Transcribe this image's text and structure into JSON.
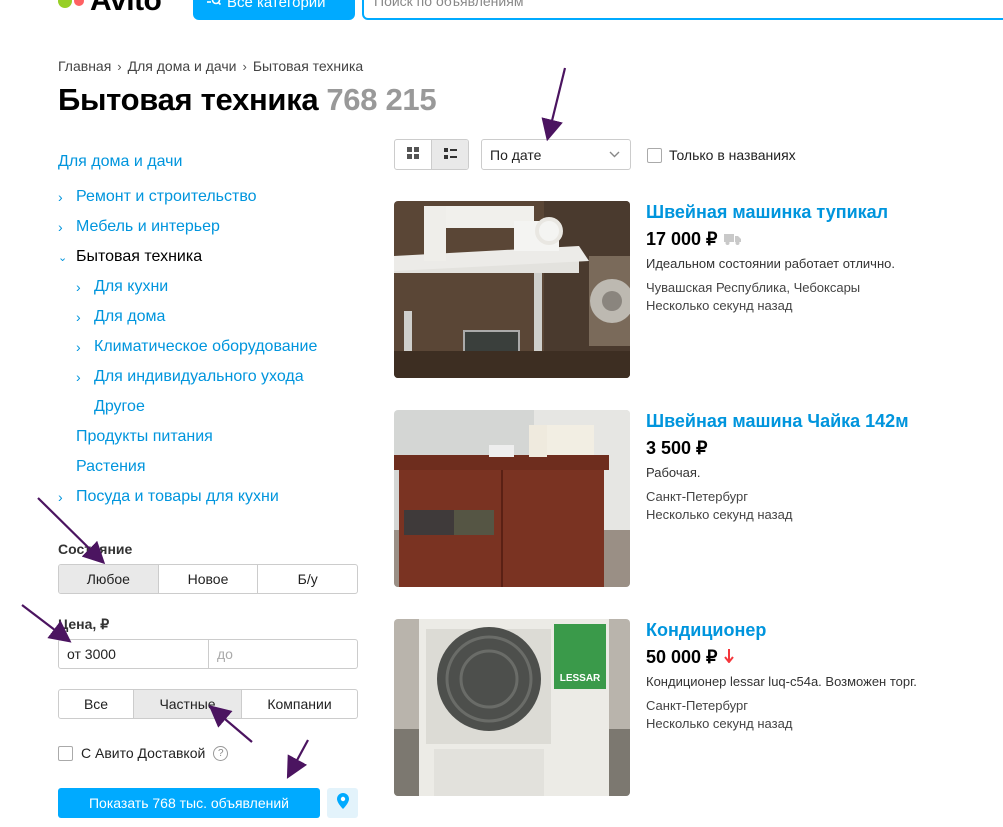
{
  "header": {
    "logo_text": "Avito",
    "logo_colors": [
      "#97cf26",
      "#ff6163",
      "#a169f7",
      "#00aaff"
    ],
    "categories_button": "Все категории",
    "search_placeholder": "Поиск по объявлениям"
  },
  "breadcrumb": [
    "Главная",
    "Для дома и дачи",
    "Бытовая техника"
  ],
  "page": {
    "title": "Бытовая техника",
    "count": "768 215"
  },
  "sidebar": {
    "heading": "Для дома и дачи",
    "items": [
      {
        "label": "Ремонт и строительство",
        "chevron": "right",
        "level": 1
      },
      {
        "label": "Мебель и интерьер",
        "chevron": "right",
        "level": 1
      },
      {
        "label": "Бытовая техника",
        "chevron": "down",
        "level": 1,
        "active": true
      },
      {
        "label": "Для кухни",
        "chevron": "right",
        "level": 2
      },
      {
        "label": "Для дома",
        "chevron": "right",
        "level": 2
      },
      {
        "label": "Климатическое оборудование",
        "chevron": "right",
        "level": 2
      },
      {
        "label": "Для индивидуального ухода",
        "chevron": "right",
        "level": 2
      },
      {
        "label": "Другое",
        "chevron": "",
        "level": 2
      },
      {
        "label": "Продукты питания",
        "chevron": "",
        "level": 1
      },
      {
        "label": "Растения",
        "chevron": "",
        "level": 1
      },
      {
        "label": "Посуда и товары для кухни",
        "chevron": "right",
        "level": 1
      }
    ]
  },
  "filters": {
    "condition_label": "Состояние",
    "condition_options": [
      "Любое",
      "Новое",
      "Б/у"
    ],
    "condition_selected": "Любое",
    "price_label": "Цена, ₽",
    "price_from": "от 3000",
    "price_to_placeholder": "до",
    "seller_options": [
      "Все",
      "Частные",
      "Компании"
    ],
    "seller_selected": "Частные",
    "delivery_label": "С Авито Доставкой",
    "show_button": "Показать 768 тыс. объявлений"
  },
  "toolbar": {
    "sort_value": "По дате",
    "names_only_label": "Только в названиях",
    "view_selected": "list"
  },
  "listings": [
    {
      "title": "Швейная машинка тупикал",
      "price": "17 000 ₽",
      "badge": "delivery-truck-icon",
      "description": "Идеальном состоянии работает отлично.",
      "location": "Чувашская Республика, Чебоксары",
      "time": "Несколько секунд назад"
    },
    {
      "title": "Швейная машина Чайка 142м",
      "price": "3 500 ₽",
      "badge": "",
      "description": "Рабочая.",
      "location": "Санкт-Петербург",
      "time": "Несколько секунд назад"
    },
    {
      "title": "Кондиционер",
      "price": "50 000 ₽",
      "badge": "price-drop-icon",
      "description": "Кондиционер lessar luq-c54a. Возможен торг.",
      "location": "Санкт-Петербург",
      "time": "Несколько секунд назад",
      "image_logo_text": "LESSAR"
    }
  ],
  "colors": {
    "accent": "#00aaff",
    "link": "#0095dd",
    "annotation_arrow": "#4b1460",
    "price_drop": "#f4373c"
  }
}
